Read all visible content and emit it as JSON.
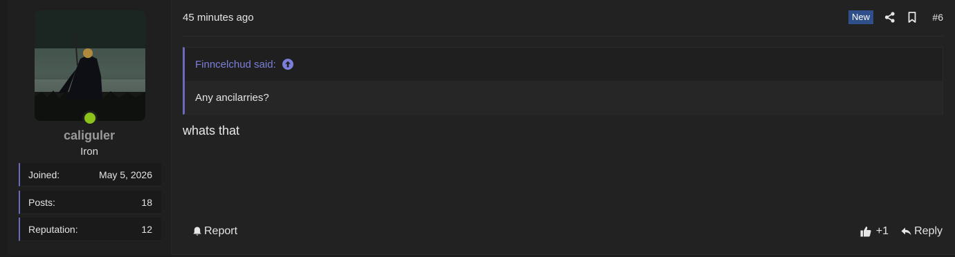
{
  "user": {
    "name": "caliguler",
    "title": "Iron",
    "stats": [
      {
        "label": "Joined:",
        "value": "May 5, 2026"
      },
      {
        "label": "Posts:",
        "value": "18"
      },
      {
        "label": "Reputation:",
        "value": "12"
      }
    ],
    "online_color": "#8cc21a"
  },
  "post": {
    "date": "45 minutes ago",
    "badge": "New",
    "number": "#6",
    "quote": {
      "author_said": "Finncelchud said:",
      "text": "Any ancilarries?"
    },
    "message": "whats that"
  },
  "actions": {
    "report": "Report",
    "reaction_count": "+1",
    "reply": "Reply"
  },
  "colors": {
    "accent": "#6a6bbd",
    "quote_author": "#7b7fd8",
    "badge_bg": "#2f4f8a"
  },
  "icons": [
    "share-icon",
    "bookmark-icon",
    "arrow-up-circle-icon",
    "bell-icon",
    "thumbs-up-icon",
    "reply-arrow-icon"
  ]
}
